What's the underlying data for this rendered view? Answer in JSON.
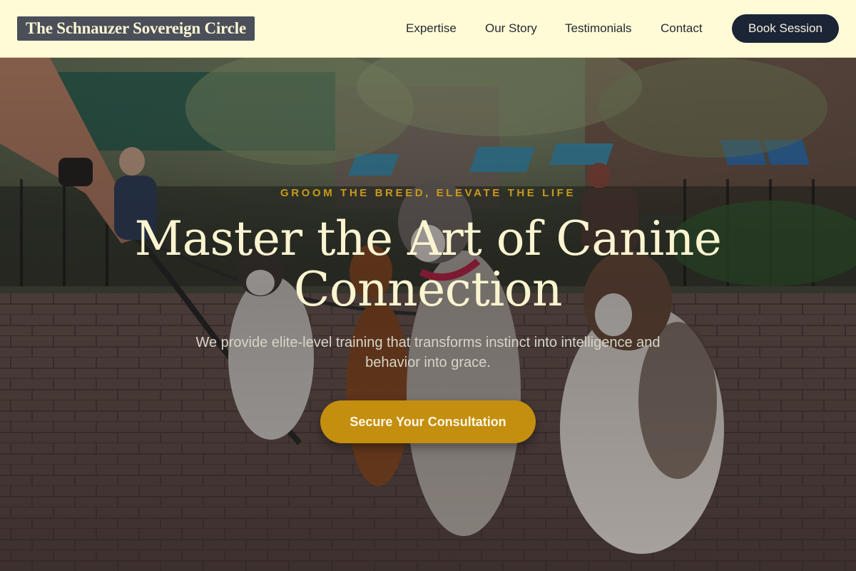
{
  "header": {
    "brand": "The Schnauzer Sovereign Circle",
    "nav": [
      "Expertise",
      "Our Story",
      "Testimonials",
      "Contact"
    ],
    "cta": "Book Session"
  },
  "hero": {
    "eyebrow": "GROOM THE BREED, ELEVATE THE LIFE",
    "headline": "Master the Art of Canine Connection",
    "subtext": "We provide elite-level training that transforms instinct into intelligence and behavior into grace.",
    "cta": "Secure Your Consultation"
  },
  "colors": {
    "header_bg": "#fefbd6",
    "brand_bg": "#4a4f59",
    "nav_text": "#272a33",
    "book_button": "#1c2536",
    "accent_gold": "#c48e0f",
    "headline_text": "#fbf4d0"
  }
}
